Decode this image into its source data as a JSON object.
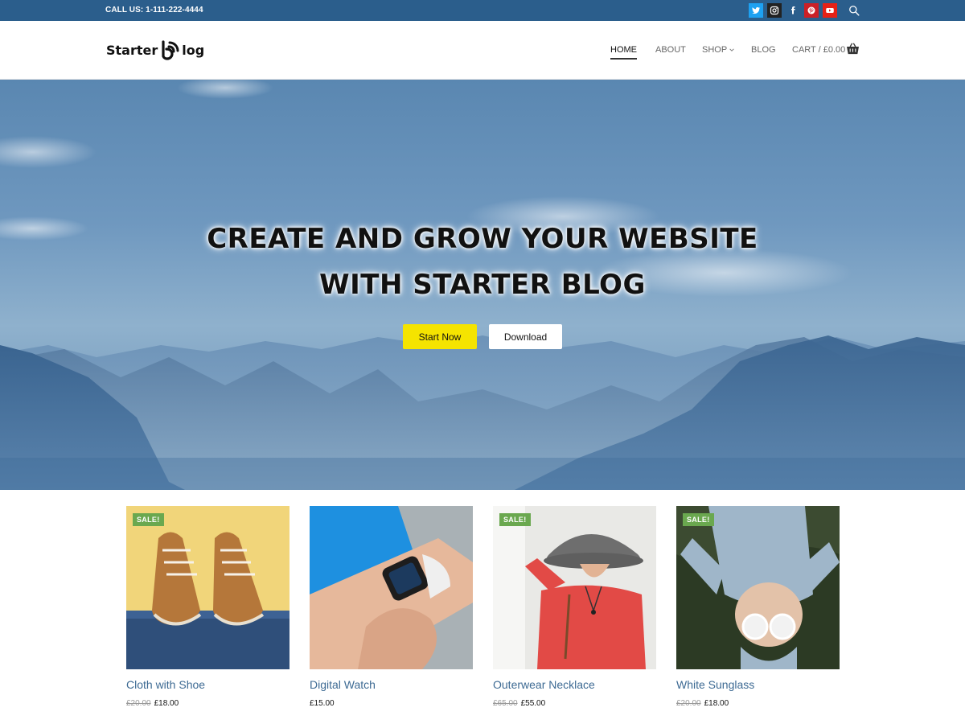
{
  "topbar": {
    "call_text": "CALL US: 1-111-222-4444",
    "socials": [
      {
        "icon": "twitter-icon",
        "color": "#1da1f2"
      },
      {
        "icon": "instagram-icon",
        "color": "#222222"
      },
      {
        "icon": "facebook-icon",
        "color": "#2b5e8c"
      },
      {
        "icon": "pinterest-icon",
        "color": "#cb2027"
      },
      {
        "icon": "youtube-icon",
        "color": "#e62117"
      }
    ],
    "search_icon": "search-icon"
  },
  "header": {
    "logo_left": "Starter",
    "logo_right": "log",
    "nav": [
      {
        "label": "HOME",
        "active": true
      },
      {
        "label": "ABOUT"
      },
      {
        "label": "SHOP"
      },
      {
        "label": "BLOG"
      },
      {
        "label": "CART / £0.00"
      }
    ]
  },
  "hero": {
    "title_line1": "CREATE AND GROW YOUR WEBSITE",
    "title_line2": "WITH STARTER BLOG",
    "primary_button": "Start Now",
    "secondary_button": "Download",
    "accent_color": "#f5e400"
  },
  "products": [
    {
      "name": "Cloth with Shoe",
      "sale": "SALE!",
      "old_price": "£20.00",
      "price": "£18.00"
    },
    {
      "name": "Digital Watch",
      "sale": "",
      "old_price": "",
      "price": "£15.00"
    },
    {
      "name": "Outerwear Necklace",
      "sale": "SALE!",
      "old_price": "£65.00",
      "price": "£55.00"
    },
    {
      "name": "White Sunglass",
      "sale": "SALE!",
      "old_price": "£20.00",
      "price": "£18.00"
    }
  ]
}
